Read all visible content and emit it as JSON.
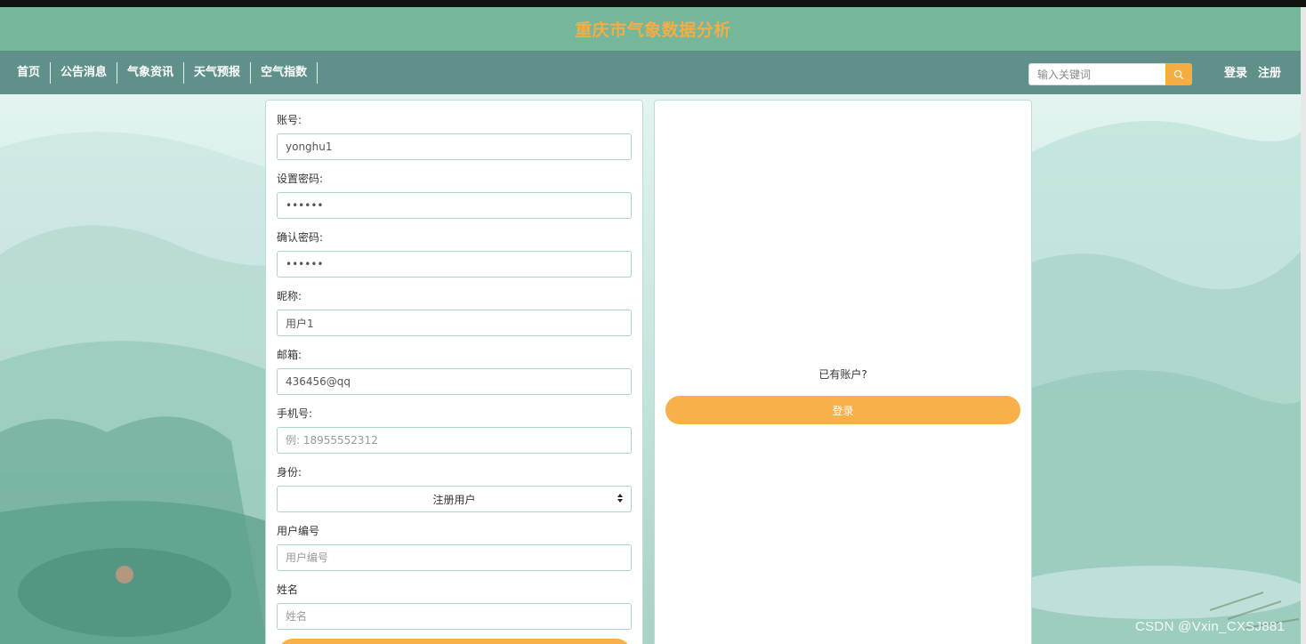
{
  "header": {
    "title": "重庆市气象数据分析"
  },
  "nav": {
    "items": [
      {
        "label": "首页"
      },
      {
        "label": "公告消息"
      },
      {
        "label": "气象资讯"
      },
      {
        "label": "天气预报"
      },
      {
        "label": "空气指数"
      }
    ],
    "search_placeholder": "输入关键词",
    "login_label": "登录",
    "register_label": "注册"
  },
  "form": {
    "account_label": "账号:",
    "account_value": "yonghu1",
    "password_label": "设置密码:",
    "password_value": "••••••",
    "confirm_label": "确认密码:",
    "confirm_value": "••••••",
    "nickname_label": "昵称:",
    "nickname_value": "用户1",
    "email_label": "邮箱:",
    "email_value": "436456@qq",
    "phone_label": "手机号:",
    "phone_placeholder": "例: 18955552312",
    "identity_label": "身份:",
    "identity_selected": "注册用户",
    "user_no_label": "用户编号",
    "user_no_placeholder": "用户编号",
    "name_label": "姓名",
    "name_placeholder": "姓名"
  },
  "login_box": {
    "prompt": "已有账户?",
    "button_label": "登录"
  },
  "watermark": "CSDN @Vxin_CXSJ881",
  "colors": {
    "title_bar": "#76b79c",
    "nav_bar": "#5f918a",
    "title_text": "#f4ad45",
    "accent_button": "#f7b04a"
  }
}
